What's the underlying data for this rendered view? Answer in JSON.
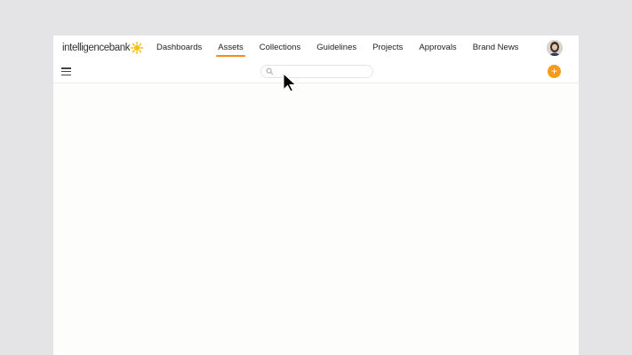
{
  "brand": {
    "logo_text": "intelligencebank",
    "accent_color": "#f08c1c"
  },
  "nav": {
    "items": [
      {
        "label": "Dashboards",
        "active": false
      },
      {
        "label": "Assets",
        "active": true
      },
      {
        "label": "Collections",
        "active": false
      },
      {
        "label": "Guidelines",
        "active": false
      },
      {
        "label": "Projects",
        "active": false
      },
      {
        "label": "Approvals",
        "active": false
      },
      {
        "label": "Brand News",
        "active": false
      }
    ]
  },
  "toolbar": {
    "menu_icon": "hamburger-menu-icon",
    "search": {
      "placeholder": "",
      "value": ""
    },
    "add_button": {
      "label": "+",
      "color": "#f59a1b"
    }
  },
  "user": {
    "avatar_icon": "user-avatar"
  }
}
